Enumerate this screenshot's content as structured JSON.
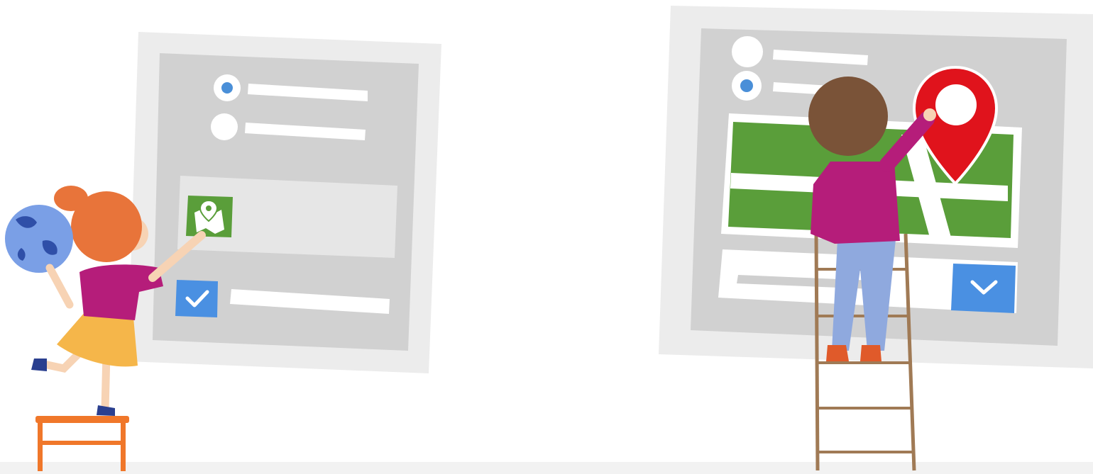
{
  "illustration": {
    "colors": {
      "background": "#ffffff",
      "floor": "#f2f2f2",
      "panel_frame": "#ececec",
      "panel_inner": "#d1d1d1",
      "panel_row": "#e6e6e6",
      "text_line": "#ffffff",
      "radio_dot": "#4a8fd8",
      "check_blue": "#4a90e2",
      "map_green": "#5a9e3a",
      "pin_red": "#e0131c",
      "shirt_magenta": "#b51d7a",
      "hair_orange": "#e8743a",
      "hair_brown": "#7a5338",
      "skirt_yellow": "#f5b64a",
      "jeans_blue": "#8fa9de",
      "stool_orange": "#f0772a",
      "ladder_brown": "#a07a55",
      "globe_blue": "#7a9fe6",
      "globe_land": "#2f4fa8"
    },
    "left_form": {
      "radio_options": [
        {
          "selected": true
        },
        {
          "selected": false
        }
      ],
      "map_tile_icon": "map-pin-icon",
      "checkbox": {
        "checked": true,
        "icon": "checkmark-icon"
      }
    },
    "right_form": {
      "radio_options": [
        {
          "selected": false
        },
        {
          "selected": true
        }
      ],
      "map_pin_icon": "location-pin-icon",
      "dropdown_icon": "chevron-down-icon"
    },
    "characters": [
      {
        "name": "girl-with-globe",
        "prop": "globe-icon"
      },
      {
        "name": "boy-on-ladder",
        "prop": "ladder"
      }
    ]
  }
}
